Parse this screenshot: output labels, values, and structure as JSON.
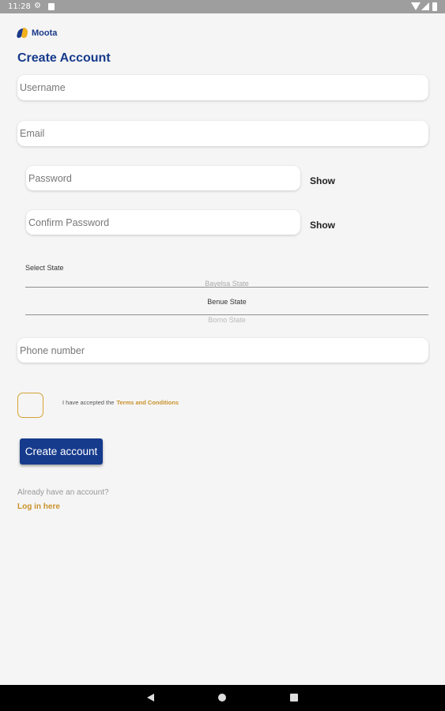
{
  "status_bar": {
    "time": "11:28",
    "icons": [
      "gear-icon",
      "sd-card-icon",
      "wifi-icon",
      "signal-icon",
      "battery-icon"
    ]
  },
  "brand": {
    "name": "Moota",
    "colors": {
      "primary": "#163a8c",
      "accent": "#c9922a",
      "logo_gold": "#f2b01e"
    }
  },
  "page_title": "Create Account",
  "form": {
    "username_placeholder": "Username",
    "email_placeholder": "Email",
    "password_placeholder": "Password",
    "confirm_password_placeholder": "Confirm Password",
    "show_label": "Show",
    "state_label": "Select State",
    "state_options": [
      "Bayelsa State",
      "Benue State",
      "Borno State"
    ],
    "state_selected": "Benue State",
    "phone_placeholder": "Phone number",
    "terms_prefix": "I have accepted the",
    "terms_link": "Terms and Conditions",
    "terms_checked": false,
    "submit_label": "Create account"
  },
  "footer": {
    "already_text": "Already have an account?",
    "login_link": "Log in here"
  },
  "nav": {
    "icons": [
      "back-icon",
      "home-icon",
      "recents-icon"
    ]
  }
}
